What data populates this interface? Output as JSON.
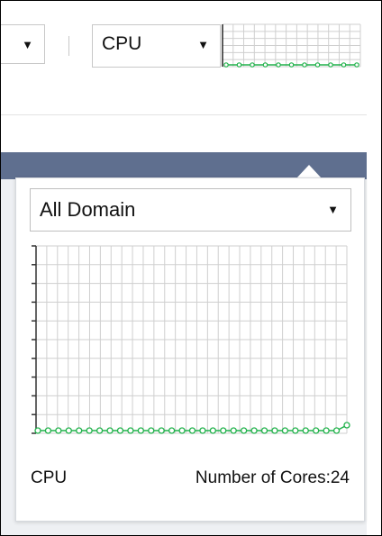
{
  "toolbar": {
    "left_select": {
      "value": "",
      "arrow": "▼"
    },
    "metric_select": {
      "value": "CPU",
      "arrow": "▼"
    }
  },
  "popover": {
    "domain_select": {
      "value": "All Domain",
      "arrow": "▼"
    },
    "footer": {
      "metric": "CPU",
      "cores": "Number of Cores:24"
    }
  },
  "colors": {
    "header_band": "#5f6f8f",
    "line": "#21b24b",
    "grid": "#cfcfcf",
    "axis": "#333333"
  },
  "chart_data": [
    {
      "type": "line",
      "name_hint": "toolbar-sparkline",
      "x": [
        1,
        2,
        3,
        4,
        5,
        6,
        7,
        8,
        9,
        10,
        11
      ],
      "series": [
        {
          "values": [
            0,
            0,
            0,
            0,
            0,
            0,
            0,
            0,
            0,
            0,
            0
          ]
        }
      ],
      "grid": true
    },
    {
      "type": "line",
      "name_hint": "popover-cpu-chart",
      "x": [
        1,
        2,
        3,
        4,
        5,
        6,
        7,
        8,
        9,
        10,
        11,
        12,
        13,
        14,
        15,
        16,
        17,
        18,
        19,
        20,
        21,
        22,
        23,
        24,
        25,
        26,
        27,
        28,
        29,
        30,
        31
      ],
      "series": [
        {
          "values": [
            0,
            0,
            0,
            0,
            0,
            0,
            0,
            0,
            0,
            0,
            0,
            0,
            0,
            0,
            0,
            0,
            0,
            0,
            0,
            0,
            0,
            0,
            0,
            0,
            0,
            0,
            0,
            0,
            0,
            0,
            0.5
          ]
        }
      ],
      "grid": true
    }
  ]
}
